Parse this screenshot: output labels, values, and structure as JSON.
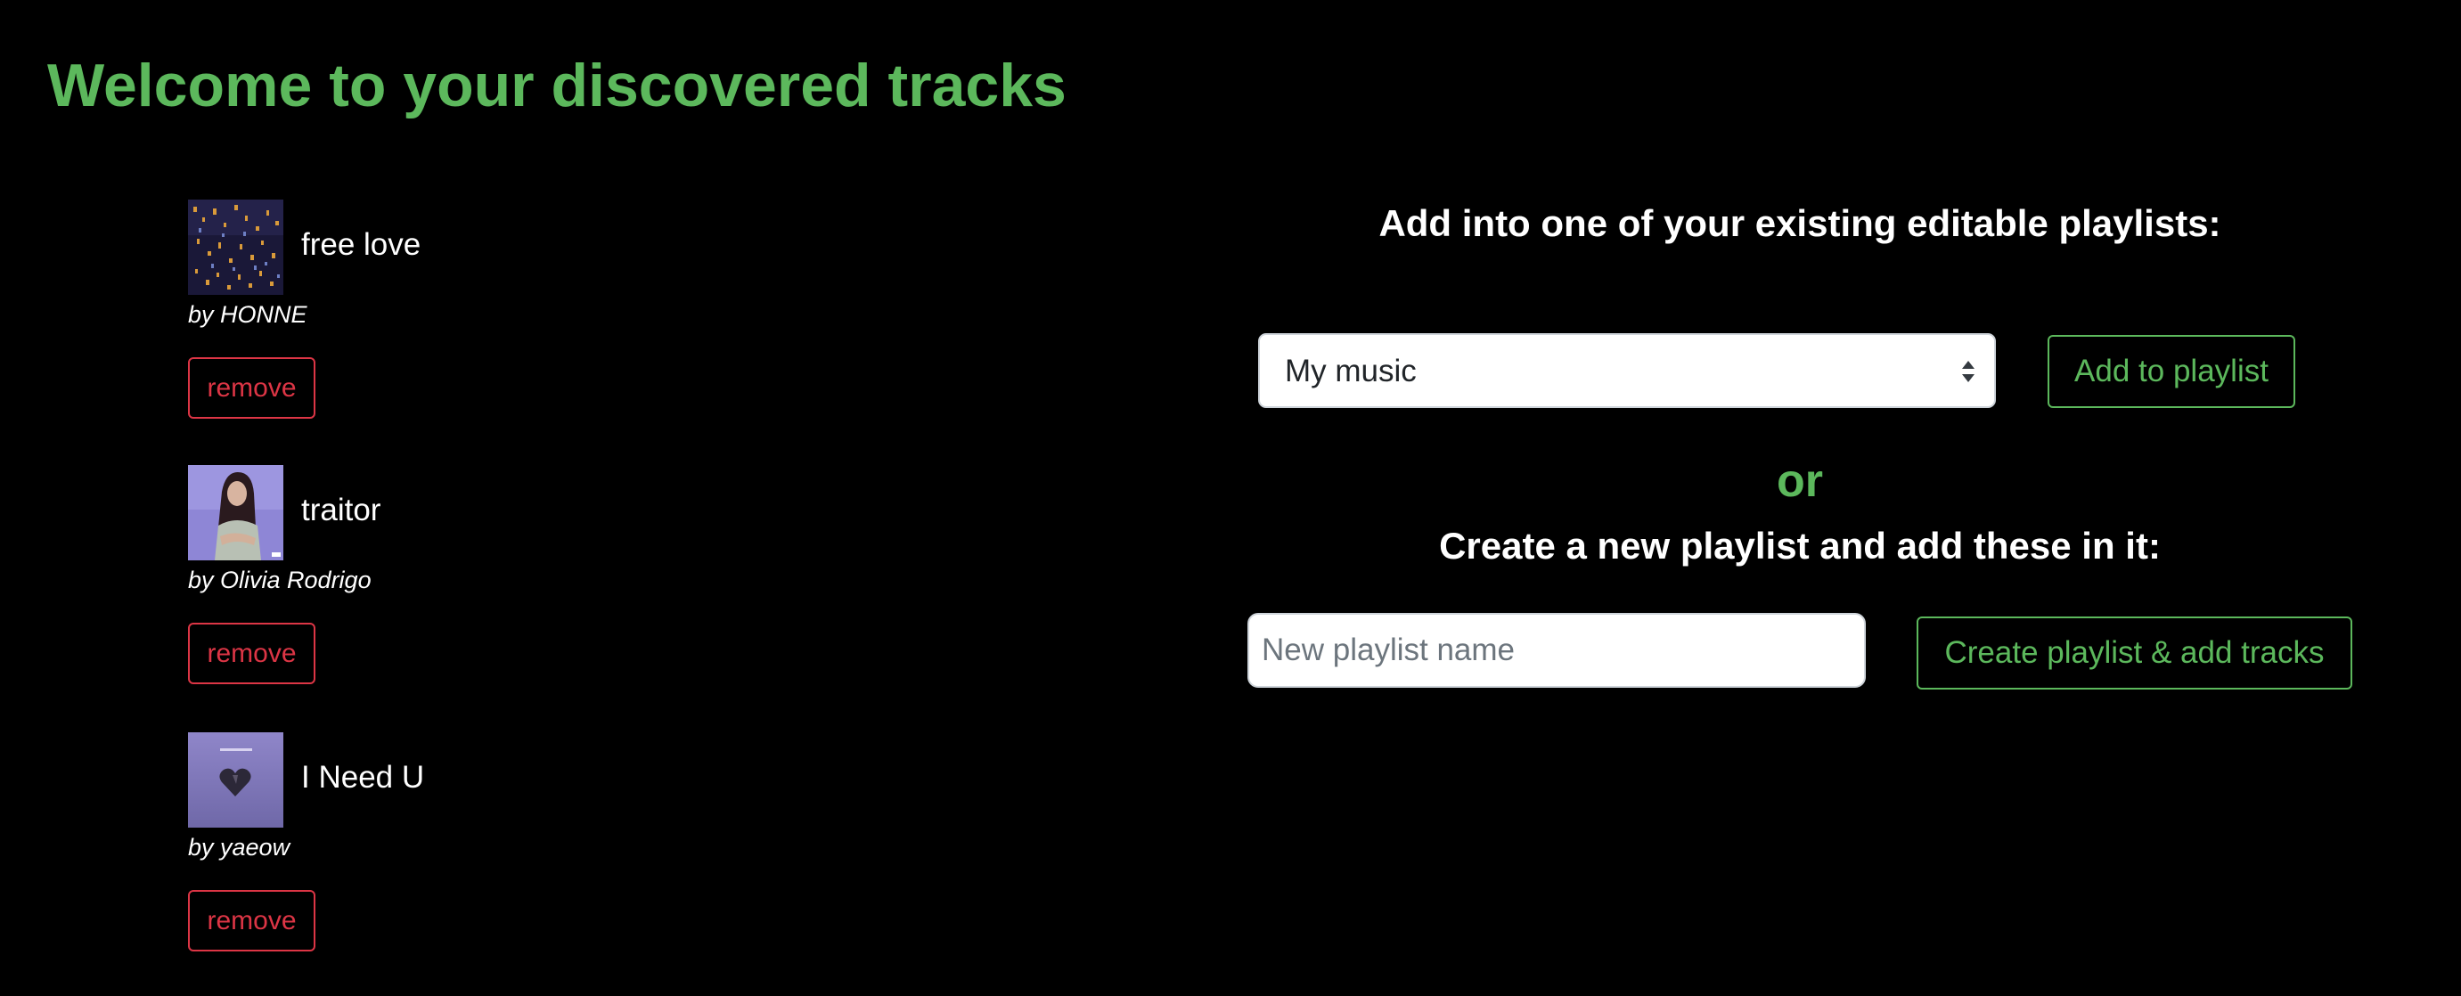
{
  "page": {
    "title": "Welcome to your discovered tracks"
  },
  "tracks": [
    {
      "name": "free love",
      "artist": "by HONNE",
      "remove_label": "remove",
      "cover_icon": "album-cover-city-lights"
    },
    {
      "name": "traitor",
      "artist": "by Olivia Rodrigo",
      "remove_label": "remove",
      "cover_icon": "album-cover-portrait"
    },
    {
      "name": "I Need U",
      "artist": "by yaeow",
      "remove_label": "remove",
      "cover_icon": "album-cover-heart"
    }
  ],
  "existing_playlist": {
    "heading": "Add into one of your existing editable playlists:",
    "selected": "My music",
    "button_label": "Add to playlist"
  },
  "or_text": "or",
  "new_playlist": {
    "heading": "Create a new playlist and add these in it:",
    "placeholder": "New playlist name",
    "value": "",
    "button_label": "Create playlist & add tracks"
  },
  "colors": {
    "background": "#000000",
    "accent_green": "#5cb85c",
    "danger_red": "#dc3545",
    "text": "#ffffff"
  }
}
